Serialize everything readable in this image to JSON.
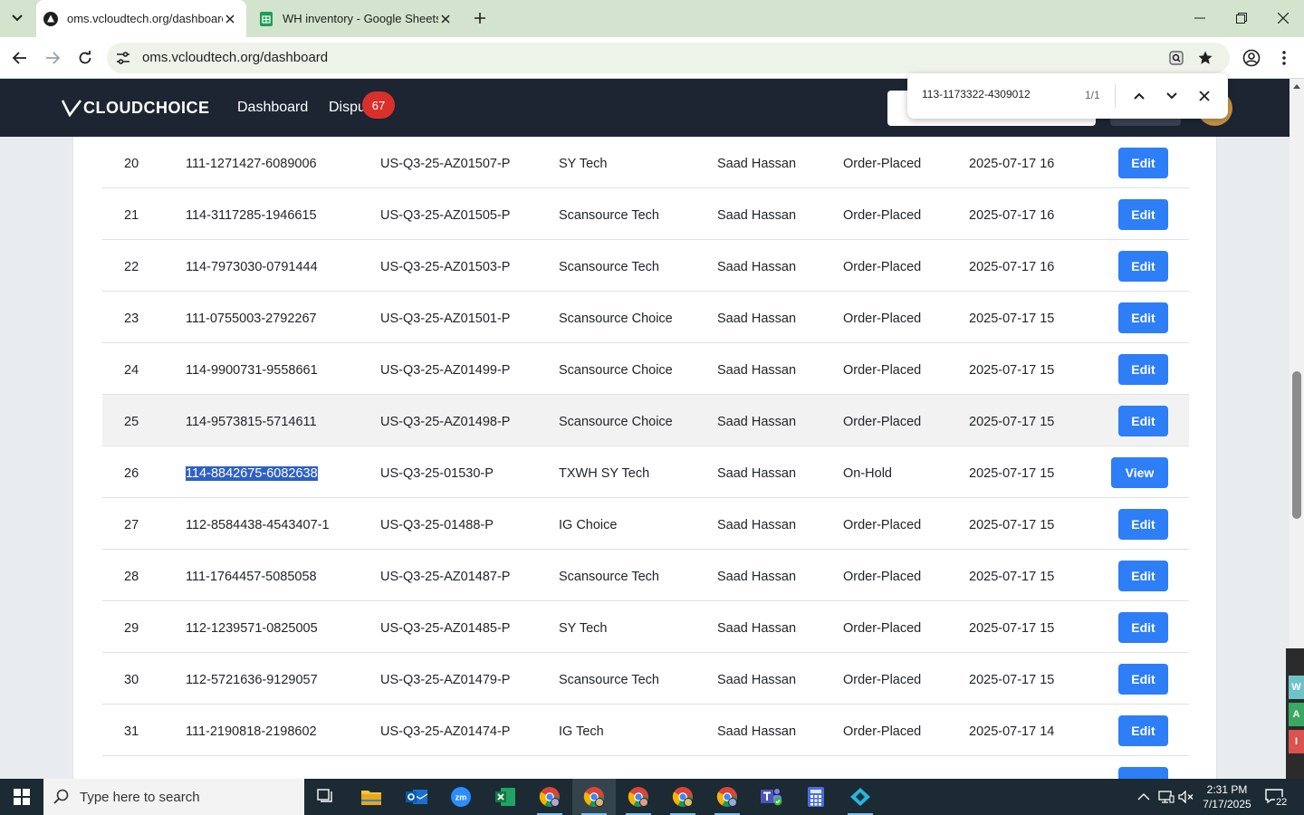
{
  "browser": {
    "tabs": [
      {
        "title": "oms.vcloudtech.org/dashboard",
        "active": true
      },
      {
        "title": "WH inventory - Google Sheets",
        "active": false
      }
    ],
    "url": "oms.vcloudtech.org/dashboard"
  },
  "find_bar": {
    "query": "113-1173322-4309012",
    "count": "1/1"
  },
  "header": {
    "brand": "CLOUDCHOICE",
    "nav": [
      {
        "label": "Dashboard"
      },
      {
        "label": "Dispu"
      }
    ],
    "badge": "67"
  },
  "orders": [
    {
      "no": "20",
      "order_id": "111-1271427-6089006",
      "ref": "US-Q3-25-AZ01507-P",
      "store": "SY Tech",
      "user": "Saad Hassan",
      "status": "Order-Placed",
      "date": "2025-07-17 16",
      "action": "Edit"
    },
    {
      "no": "21",
      "order_id": "114-3117285-1946615",
      "ref": "US-Q3-25-AZ01505-P",
      "store": "Scansource Tech",
      "user": "Saad Hassan",
      "status": "Order-Placed",
      "date": "2025-07-17 16",
      "action": "Edit"
    },
    {
      "no": "22",
      "order_id": "114-7973030-0791444",
      "ref": "US-Q3-25-AZ01503-P",
      "store": "Scansource Tech",
      "user": "Saad Hassan",
      "status": "Order-Placed",
      "date": "2025-07-17 16",
      "action": "Edit"
    },
    {
      "no": "23",
      "order_id": "111-0755003-2792267",
      "ref": "US-Q3-25-AZ01501-P",
      "store": "Scansource Choice",
      "user": "Saad Hassan",
      "status": "Order-Placed",
      "date": "2025-07-17 15",
      "action": "Edit"
    },
    {
      "no": "24",
      "order_id": "114-9900731-9558661",
      "ref": "US-Q3-25-AZ01499-P",
      "store": "Scansource Choice",
      "user": "Saad Hassan",
      "status": "Order-Placed",
      "date": "2025-07-17 15",
      "action": "Edit"
    },
    {
      "no": "25",
      "order_id": "114-9573815-5714611",
      "ref": "US-Q3-25-AZ01498-P",
      "store": "Scansource Choice",
      "user": "Saad Hassan",
      "status": "Order-Placed",
      "date": "2025-07-17 15",
      "action": "Edit"
    },
    {
      "no": "26",
      "order_id": "114-8842675-6082638",
      "ref": "US-Q3-25-01530-P",
      "store": "TXWH SY Tech",
      "user": "Saad Hassan",
      "status": "On-Hold",
      "date": "2025-07-17 15",
      "action": "View"
    },
    {
      "no": "27",
      "order_id": "112-8584438-4543407-1",
      "ref": "US-Q3-25-01488-P",
      "store": "IG Choice",
      "user": "Saad Hassan",
      "status": "Order-Placed",
      "date": "2025-07-17 15",
      "action": "Edit"
    },
    {
      "no": "28",
      "order_id": "111-1764457-5085058",
      "ref": "US-Q3-25-AZ01487-P",
      "store": "Scansource Tech",
      "user": "Saad Hassan",
      "status": "Order-Placed",
      "date": "2025-07-17 15",
      "action": "Edit"
    },
    {
      "no": "29",
      "order_id": "112-1239571-0825005",
      "ref": "US-Q3-25-AZ01485-P",
      "store": "SY Tech",
      "user": "Saad Hassan",
      "status": "Order-Placed",
      "date": "2025-07-17 15",
      "action": "Edit"
    },
    {
      "no": "30",
      "order_id": "112-5721636-9129057",
      "ref": "US-Q3-25-AZ01479-P",
      "store": "Scansource Tech",
      "user": "Saad Hassan",
      "status": "Order-Placed",
      "date": "2025-07-17 15",
      "action": "Edit"
    },
    {
      "no": "31",
      "order_id": "111-2190818-2198602",
      "ref": "US-Q3-25-AZ01474-P",
      "store": "IG Tech",
      "user": "Saad Hassan",
      "status": "Order-Placed",
      "date": "2025-07-17 14",
      "action": "Edit"
    }
  ],
  "side_widget_tabs": [
    "W",
    "A",
    "I"
  ],
  "taskbar": {
    "search_placeholder": "Type here to search",
    "apps": [
      "task-view",
      "file-explorer",
      "outlook",
      "zoom",
      "excel",
      "chrome",
      "chrome",
      "chrome",
      "chrome",
      "chrome",
      "teams",
      "calculator",
      "app"
    ],
    "time": "2:31 PM",
    "date": "7/17/2025",
    "notifications": "22"
  },
  "colors": {
    "tabbar": "#d3e3cd",
    "header": "#1d2532",
    "primary_button": "#2d7ef7",
    "badge": "#d9302c",
    "highlight": "#2e60c3",
    "taskbar": "#1b2a33"
  }
}
